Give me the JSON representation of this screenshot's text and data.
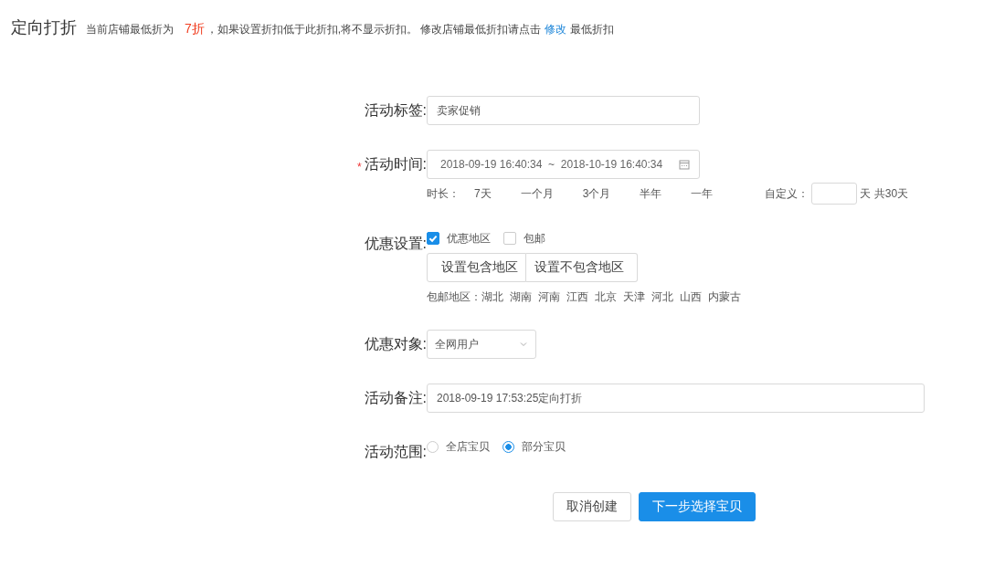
{
  "page_title": "定向打折",
  "notice": [
    {
      "kind": "text",
      "text": "当前店铺最低折为"
    },
    {
      "kind": "highlight",
      "text": "7折"
    },
    {
      "kind": "text",
      "text": "，如果设置折扣低于此折扣,将不显示折扣。 修改店铺最低折扣请点击"
    },
    {
      "kind": "link",
      "text": "修改"
    },
    {
      "kind": "text",
      "text": "最低折扣"
    }
  ],
  "form": [
    {
      "kind": "input",
      "label": "活动标签:",
      "value": "卖家促销"
    },
    {
      "kind": "daterange",
      "required_mark": "*",
      "label": "活动时间:",
      "start": "2018-09-19 16:40:34",
      "separator": "~",
      "end": "2018-10-19 16:40:34",
      "duration_label": "时长：",
      "durations": [
        "7天",
        "一个月",
        "3个月",
        "半年",
        "一年"
      ],
      "custom_label": "自定义：",
      "custom_suffix": "天 共30天"
    },
    {
      "kind": "checks",
      "label": "优惠设置:",
      "options": [
        {
          "label": "优惠地区",
          "checked": true
        },
        {
          "label": "包邮",
          "checked": false
        }
      ],
      "buttons": [
        "设置包含地区",
        "设置不包含地区"
      ],
      "region_label": "包邮地区：",
      "regions": [
        "湖北",
        "湖南",
        "河南",
        "江西",
        "北京",
        "天津",
        "河北",
        "山西",
        "内蒙古"
      ]
    },
    {
      "kind": "select",
      "label": "优惠对象:",
      "value": "全网用户"
    },
    {
      "kind": "wideinput",
      "label": "活动备注:",
      "value": "2018-09-19 17:53:25定向打折"
    },
    {
      "kind": "radio",
      "label": "活动范围:",
      "options": [
        {
          "label": "全店宝贝",
          "selected": false
        },
        {
          "label": "部分宝贝",
          "selected": true
        }
      ]
    }
  ],
  "actions": [
    {
      "kind": "secondary",
      "label": "取消创建"
    },
    {
      "kind": "primary",
      "label": "下一步选择宝贝"
    }
  ]
}
